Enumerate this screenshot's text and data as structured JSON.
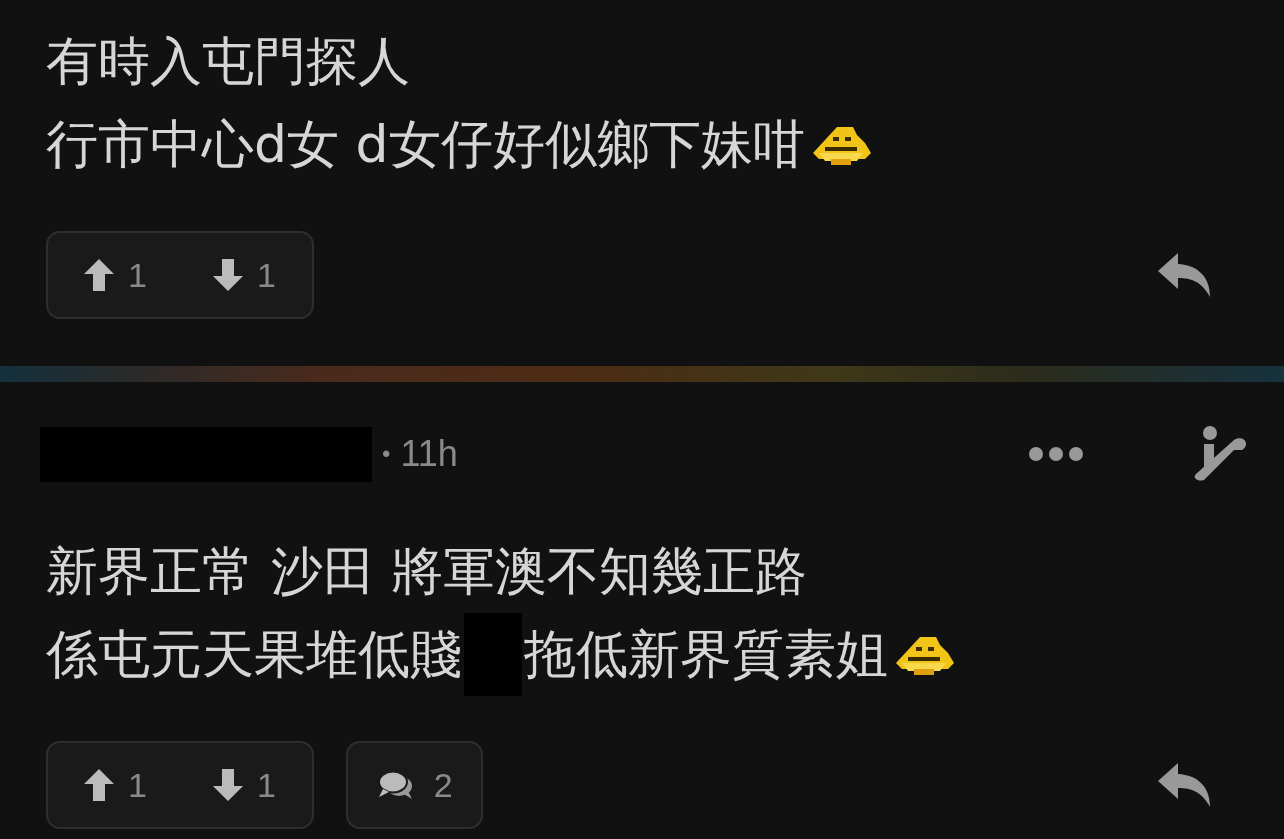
{
  "posts": [
    {
      "lines": [
        {
          "texts": [
            "有時入屯門探人"
          ],
          "emoji": false
        },
        {
          "texts": [
            "行市中心d女 d女仔好似鄉下妹咁"
          ],
          "emoji": true
        }
      ],
      "upvotes": "1",
      "downvotes": "1"
    },
    {
      "header": {
        "author_redacted": true,
        "bullet": "•",
        "time": "11h"
      },
      "lines": [
        {
          "texts": [
            "新界正常 沙田 將軍澳不知幾正路"
          ],
          "emoji": false
        },
        {
          "texts": [
            "係屯元天果堆低賤",
            "拖低新界質素姐"
          ],
          "emoji": true
        }
      ],
      "upvotes": "1",
      "downvotes": "1",
      "replies": "2"
    }
  ]
}
